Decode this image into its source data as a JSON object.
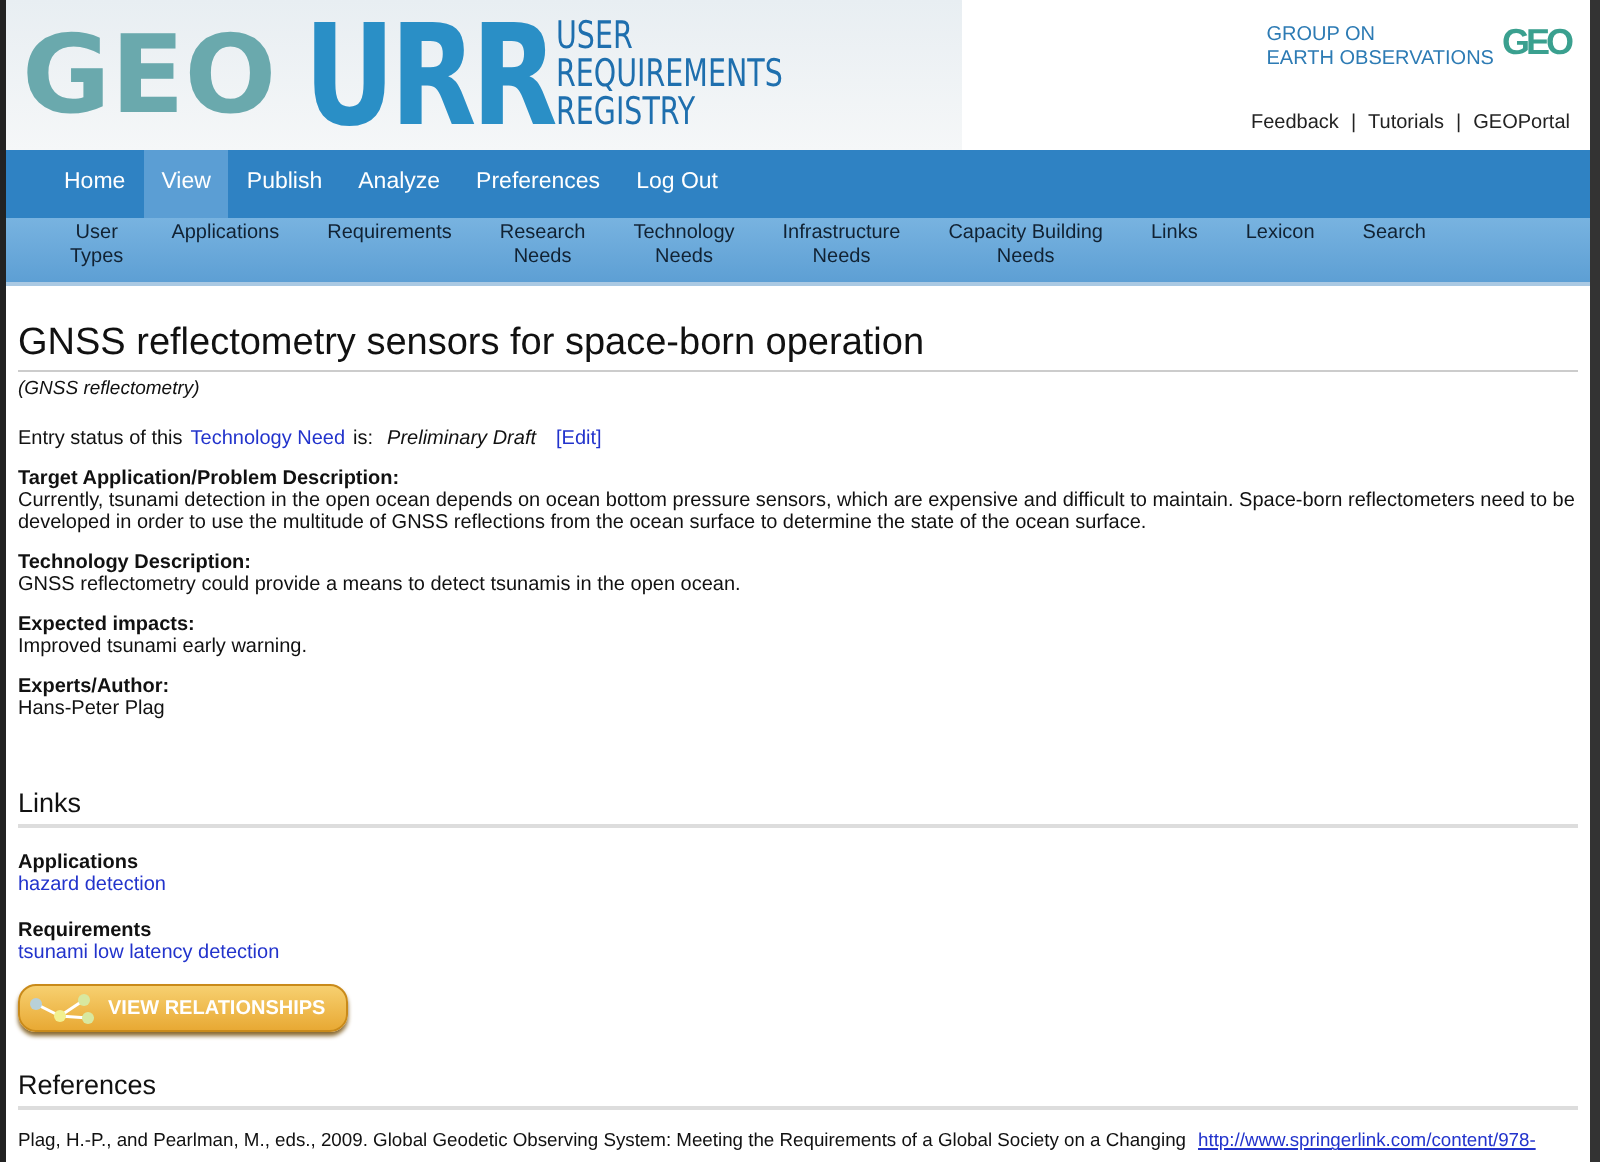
{
  "header": {
    "logo_letters": "GEO",
    "app_letters": "URR",
    "app_name": [
      "USER",
      "REQUIREMENTS",
      "REGISTRY"
    ],
    "org_name": [
      "GROUP ON",
      "EARTH OBSERVATIONS"
    ],
    "org_letters": "GEO",
    "top_links": [
      "Feedback",
      "Tutorials",
      "GEOPortal"
    ],
    "separator": "|"
  },
  "nav": [
    {
      "label": "Home",
      "selected": false
    },
    {
      "label": "View",
      "selected": true
    },
    {
      "label": "Publish",
      "selected": false
    },
    {
      "label": "Analyze",
      "selected": false
    },
    {
      "label": "Preferences",
      "selected": false
    },
    {
      "label": "Log Out",
      "selected": false
    }
  ],
  "subnav": [
    [
      "User",
      "Types"
    ],
    [
      "Applications"
    ],
    [
      "Requirements"
    ],
    [
      "Research",
      "Needs"
    ],
    [
      "Technology",
      "Needs"
    ],
    [
      "Infrastructure",
      "Needs"
    ],
    [
      "Capacity Building",
      "Needs"
    ],
    [
      "Links"
    ],
    [
      "Lexicon"
    ],
    [
      "Search"
    ]
  ],
  "title": "GNSS reflectometry sensors for space-born operation",
  "subtitle": "(GNSS reflectometry)",
  "status": {
    "prefix": "Entry status of this",
    "link": "Technology Need",
    "middle": "is:",
    "value": "Preliminary Draft",
    "edit": "[Edit]"
  },
  "fields": [
    {
      "label": "Target Application/Problem Description:",
      "value": "Currently, tsunami detection in the open ocean depends on ocean bottom pressure sensors, which are expensive and difficult to maintain. Space-born reflectometers need to be developed in order to use the multitude of GNSS reflections from the ocean surface to determine the state of the ocean surface."
    },
    {
      "label": "Technology Description:",
      "value": "GNSS reflectometry could provide a means to detect tsunamis in the open ocean."
    },
    {
      "label": "Expected impacts:",
      "value": "Improved tsunami early warning."
    },
    {
      "label": "Experts/Author:",
      "value": "Hans-Peter Plag"
    }
  ],
  "links_section": {
    "heading": "Links",
    "groups": [
      {
        "heading": "Applications",
        "items": [
          "hazard detection"
        ]
      },
      {
        "heading": "Requirements",
        "items": [
          "tsunami low latency detection"
        ]
      }
    ],
    "button": "VIEW RELATIONSHIPS"
  },
  "references": {
    "heading": "References",
    "text": "Plag, H.-P., and Pearlman, M., eds., 2009. Global Geodetic Observing System: Meeting the Requirements of a Global Society on a Changing",
    "link": "http://www.springerlink.com/content/978-"
  }
}
